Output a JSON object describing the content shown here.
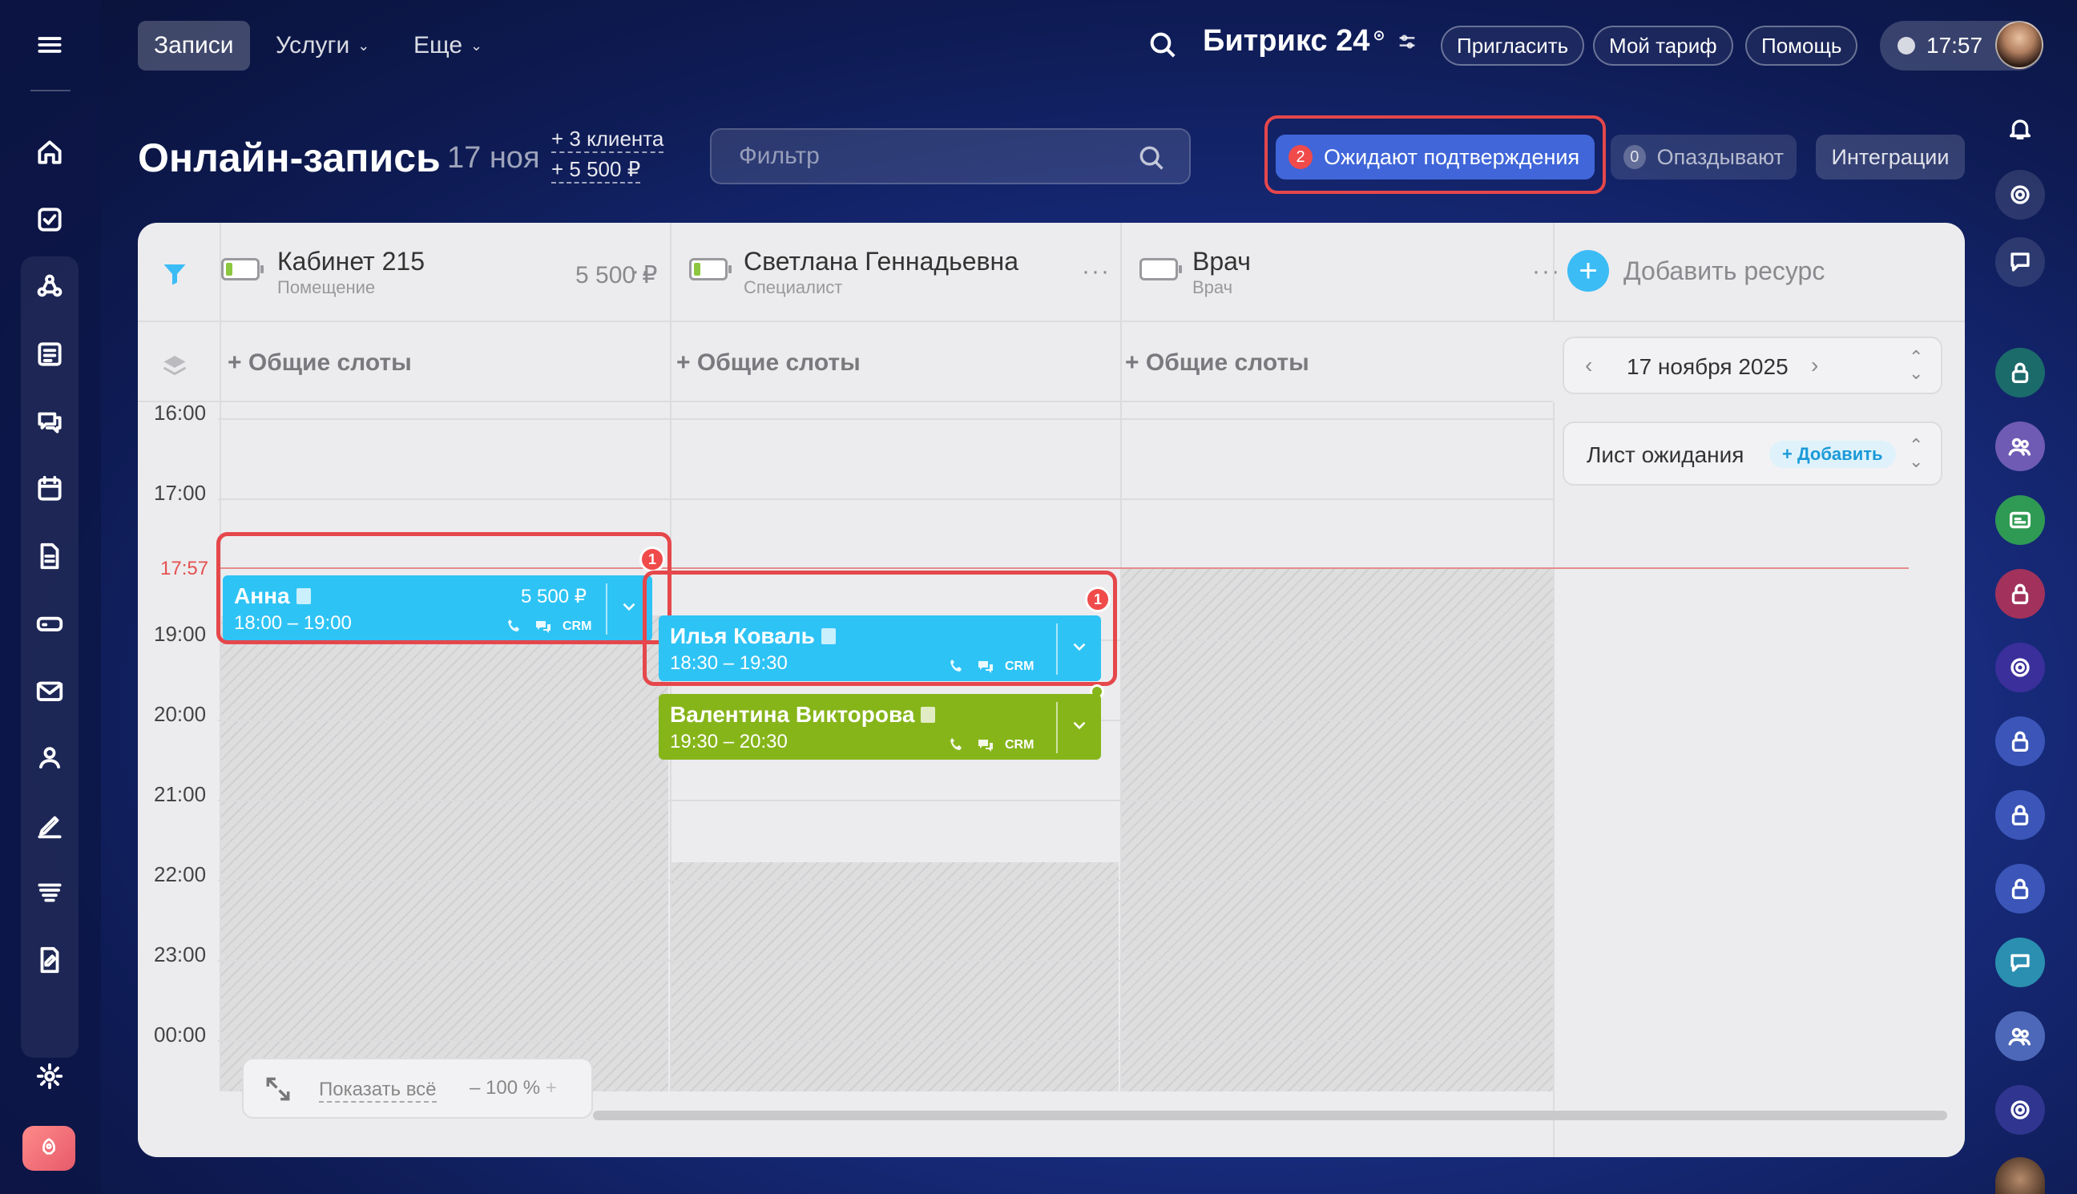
{
  "topbar": {
    "tabs": [
      {
        "label": "Записи",
        "active": true
      },
      {
        "label": "Услуги",
        "has_dropdown": true
      },
      {
        "label": "Еще",
        "has_dropdown": true
      }
    ],
    "brand": "Битрикс 24",
    "buttons": [
      "Пригласить",
      "Мой тариф",
      "Помощь"
    ],
    "clock": "17:57"
  },
  "header": {
    "title": "Онлайн-запись",
    "date": "17 ноя",
    "stats": [
      "+ 3 клиента",
      "+ 5 500 ₽"
    ],
    "filter_placeholder": "Фильтр",
    "pending": {
      "count": "2",
      "label": "Ожидают подтверждения"
    },
    "late": {
      "count": "0",
      "label": "Опаздывают"
    },
    "integrations": "Интеграции"
  },
  "resources": [
    {
      "name": "Кабинет 215",
      "type": "Помещение",
      "price": "5 500 ₽",
      "battery_color": "#8dc63f"
    },
    {
      "name": "Светлана Геннадьевна",
      "type": "Специалист",
      "price": "",
      "battery_color": "#8dc63f"
    },
    {
      "name": "Врач",
      "type": "Врач",
      "price": "",
      "battery_color": ""
    }
  ],
  "add_resource": "Добавить ресурс",
  "slots": [
    "+ Общие слоты",
    "+ Общие слоты",
    "+ Общие слоты"
  ],
  "time_labels": [
    "16:00",
    "17:00",
    "19:00",
    "20:00",
    "21:00",
    "22:00",
    "23:00",
    "00:00"
  ],
  "now_label": "17:57",
  "appointments": [
    {
      "name": "Анна",
      "time": "18:00 – 19:00",
      "price": "5 500 ₽",
      "color": "blue",
      "crm": "CRM",
      "badge": "1"
    },
    {
      "name": "Илья Коваль",
      "time": "18:30 – 19:30",
      "price": "",
      "color": "blue",
      "crm": "CRM",
      "badge": "1"
    },
    {
      "name": "Валентина Викторова",
      "time": "19:30 – 20:30",
      "price": "",
      "color": "green",
      "crm": "CRM",
      "badge": ""
    }
  ],
  "date_picker": "17 ноября 2025",
  "waitlist": {
    "label": "Лист ожидания",
    "add": "+ Добавить"
  },
  "zoom": {
    "show_all": "Показать всё",
    "level": "100 %"
  },
  "colors": {
    "accent_blue": "#2ec3f5",
    "accent_green": "#86b51a",
    "highlight_red": "#e5474b"
  }
}
